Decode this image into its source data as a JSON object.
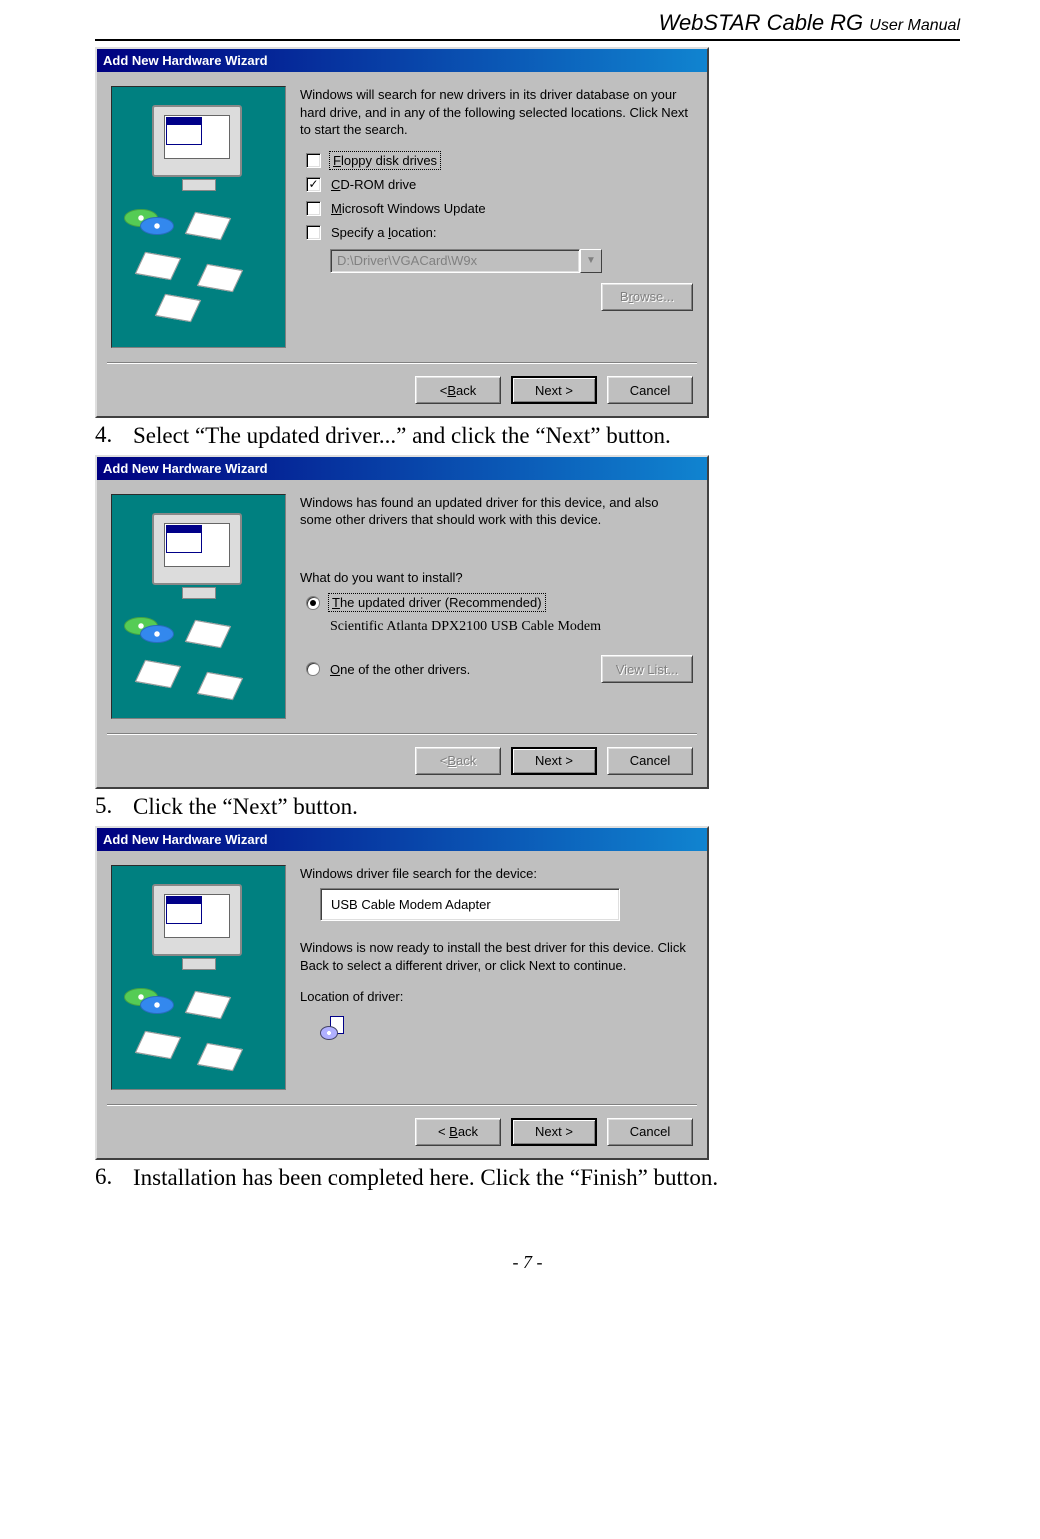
{
  "header": {
    "product": "WebSTAR Cable RG",
    "subtitle": "User Manual"
  },
  "steps": {
    "s4_num": "4.",
    "s4_text": "Select “The updated driver...” and click the “Next” button.",
    "s5_num": "5.",
    "s5_text": "Click the “Next” button.",
    "s6_num": "6.",
    "s6_text": "Installation has been completed here. Click the “Finish” button."
  },
  "dlg1": {
    "title": "Add New Hardware Wizard",
    "intro": "Windows will search for new drivers in its driver database on your hard drive, and in any of the following selected locations. Click Next to start the search.",
    "opt_floppy": "Floppy disk drives",
    "opt_floppy_u": "F",
    "opt_cd": "CD-ROM drive",
    "opt_cd_u": "C",
    "opt_ms": "Microsoft Windows Update",
    "opt_ms_u": "M",
    "opt_loc": "Specify a location:",
    "opt_loc_u": "l",
    "path_value": "D:\\Driver\\VGACard\\W9x",
    "browse": "Browse...",
    "browse_u": "r",
    "back": "< Back",
    "back_u": "B",
    "next": "Next >",
    "cancel": "Cancel"
  },
  "dlg2": {
    "title": "Add New Hardware Wizard",
    "intro": "Windows has found an updated driver for this device, and also some other drivers that should work with this device.",
    "question": "What do you want to install?",
    "opt_updated": "The updated driver (Recommended)",
    "opt_updated_u": "T",
    "found_driver": "Scientific Atlanta DPX2100 USB Cable Modem",
    "opt_other": "One of the other drivers.",
    "opt_other_u": "O",
    "viewlist": "View List...",
    "back": "< Back",
    "back_u": "B",
    "next": "Next >",
    "cancel": "Cancel"
  },
  "dlg3": {
    "title": "Add New Hardware Wizard",
    "line1": "Windows driver file search for the device:",
    "device_name": "USB Cable Modem Adapter",
    "line2": "Windows is now ready to install the best driver for this device. Click Back to select a different driver, or click Next to continue.",
    "loc_label": "Location of driver:",
    "back": "<  Back",
    "back_u": "B",
    "next": "Next >",
    "cancel": "Cancel"
  },
  "footer": {
    "page_label": "- 7 -"
  }
}
